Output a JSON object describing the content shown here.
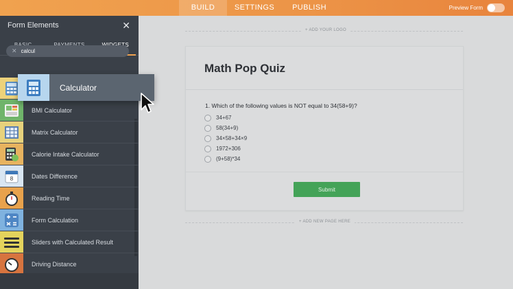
{
  "topbar": {
    "tabs": [
      {
        "label": "BUILD",
        "active": true
      },
      {
        "label": "SETTINGS",
        "active": false
      },
      {
        "label": "PUBLISH",
        "active": false
      }
    ],
    "preview_label": "Preview Form"
  },
  "panel": {
    "title": "Form Elements",
    "tabs": [
      {
        "label": "BASIC"
      },
      {
        "label": "PAYMENTS"
      },
      {
        "label": "WIDGETS",
        "active": true
      }
    ],
    "search_value": "calcul",
    "items": [
      {
        "label": "BMI Calculator",
        "icon": "bmi-icon",
        "color": "#6fb46a"
      },
      {
        "label": "Matrix Calculator",
        "icon": "matrix-icon",
        "color": "#e7d27c"
      },
      {
        "label": "Calorie Intake Calculator",
        "icon": "calorie-icon",
        "color": "#e7b35f"
      },
      {
        "label": "Dates Difference",
        "icon": "calendar-icon",
        "color": "#d9e6f2"
      },
      {
        "label": "Reading Time",
        "icon": "stopwatch-icon",
        "color": "#e8a24c"
      },
      {
        "label": "Form Calculation",
        "icon": "math-icon",
        "color": "#7fb2df"
      },
      {
        "label": "Sliders with Calculated Result",
        "icon": "sliders-icon",
        "color": "#e4d35c"
      },
      {
        "label": "Driving Distance",
        "icon": "speedometer-icon",
        "color": "#d7743f"
      }
    ]
  },
  "drag": {
    "label": "Calculator",
    "icon": "calculator-icon"
  },
  "form": {
    "logo_hint": "+ ADD YOUR LOGO",
    "title": "Math Pop Quiz",
    "question": "1. Which of the following values is NOT equal to 34(58+9)?",
    "options": [
      "34+67",
      "58(34+9)",
      "34×58+34×9",
      "1972+306",
      "(9+58)*34"
    ],
    "submit_label": "Submit",
    "new_page_hint": "+ ADD NEW PAGE HERE"
  }
}
